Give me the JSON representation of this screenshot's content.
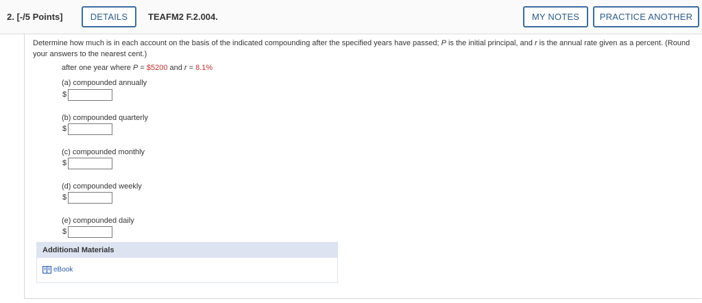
{
  "header": {
    "question_number": "2.  [-/5 Points]",
    "details_label": "DETAILS",
    "question_code": "TEAFM2 F.2.004.",
    "my_notes_label": "MY NOTES",
    "practice_label": "PRACTICE ANOTHER"
  },
  "question": {
    "prompt_part1": "Determine how much is in each account on the basis of the indicated compounding after the specified years have passed; ",
    "p_var": "P",
    "prompt_part2": " is the initial principal, and ",
    "r_var": "r",
    "prompt_part3": " is the annual rate given as a percent. (Round your answers to the nearest cent.)",
    "scenario_prefix": "after one year where ",
    "scenario_p": "P",
    "scenario_eq1": " = ",
    "principal": "$5200",
    "scenario_and": " and ",
    "scenario_r": "r",
    "scenario_eq2": " = ",
    "rate": "8.1%"
  },
  "parts": [
    {
      "label": "(a) compounded annually",
      "currency": "$",
      "value": ""
    },
    {
      "label": "(b) compounded quarterly",
      "currency": "$",
      "value": ""
    },
    {
      "label": "(c) compounded monthly",
      "currency": "$",
      "value": ""
    },
    {
      "label": "(d) compounded weekly",
      "currency": "$",
      "value": ""
    },
    {
      "label": "(e) compounded daily",
      "currency": "$",
      "value": ""
    }
  ],
  "additional_materials": {
    "title": "Additional Materials",
    "items": [
      {
        "label": "eBook",
        "icon": "book-icon"
      }
    ]
  }
}
